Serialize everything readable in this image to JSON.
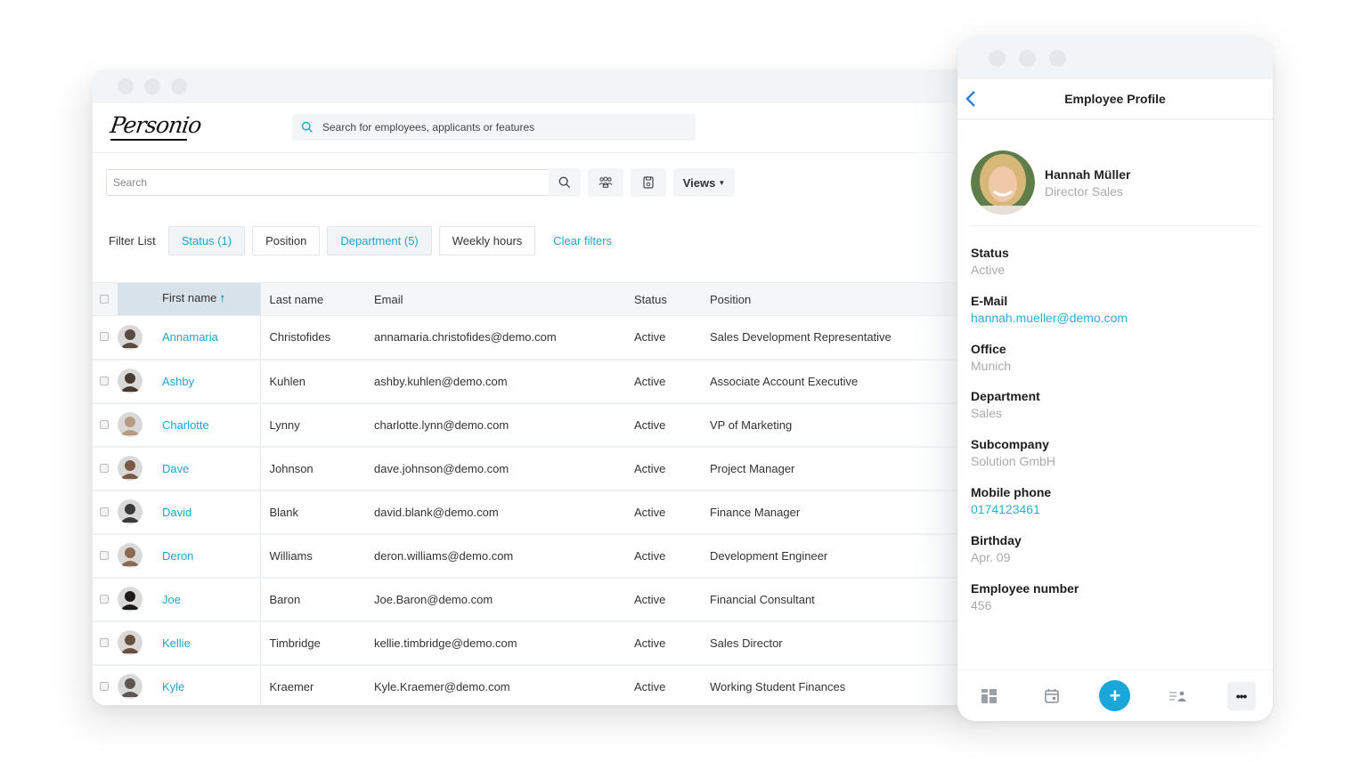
{
  "app": {
    "logo_text": "Personio",
    "global_search_placeholder": "Search for employees, applicants or features"
  },
  "toolbar": {
    "search_placeholder": "Search",
    "views_label": "Views",
    "icons": [
      "search-icon",
      "people-icon",
      "save-icon",
      "chevron-down-icon"
    ]
  },
  "filters": {
    "label": "Filter List",
    "chips": [
      {
        "label": "Status (1)",
        "active": true
      },
      {
        "label": "Position",
        "active": false
      },
      {
        "label": "Department (5)",
        "active": true
      },
      {
        "label": "Weekly hours",
        "active": false
      }
    ],
    "clear_label": "Clear filters"
  },
  "table": {
    "columns": [
      "First name",
      "Last name",
      "Email",
      "Status",
      "Position"
    ],
    "sorted_column": "First name",
    "sort_direction": "asc",
    "rows": [
      {
        "first": "Annamaria",
        "last": "Christofides",
        "email": "annamaria.christofides@demo.com",
        "status": "Active",
        "position": "Sales Development Representative",
        "avatar_color": "#5a4a42"
      },
      {
        "first": "Ashby",
        "last": "Kuhlen",
        "email": "ashby.kuhlen@demo.com",
        "status": "Active",
        "position": "Associate Account Executive",
        "avatar_color": "#4b3a30"
      },
      {
        "first": "Charlotte",
        "last": "Lynny",
        "email": "charlotte.lynn@demo.com",
        "status": "Active",
        "position": "VP of Marketing",
        "avatar_color": "#b89a7e"
      },
      {
        "first": "Dave",
        "last": "Johnson",
        "email": "dave.johnson@demo.com",
        "status": "Active",
        "position": "Project Manager",
        "avatar_color": "#7a5a44"
      },
      {
        "first": "David",
        "last": "Blank",
        "email": "david.blank@demo.com",
        "status": "Active",
        "position": "Finance Manager",
        "avatar_color": "#3a3a3a"
      },
      {
        "first": "Deron",
        "last": "Williams",
        "email": "deron.williams@demo.com",
        "status": "Active",
        "position": "Development Engineer",
        "avatar_color": "#8a6a50"
      },
      {
        "first": "Joe",
        "last": "Baron",
        "email": "Joe.Baron@demo.com",
        "status": "Active",
        "position": "Financial Consultant",
        "avatar_color": "#1e1a18"
      },
      {
        "first": "Kellie",
        "last": "Timbridge",
        "email": "kellie.timbridge@demo.com",
        "status": "Active",
        "position": "Sales Director",
        "avatar_color": "#6a4e3e"
      },
      {
        "first": "Kyle",
        "last": "Kraemer",
        "email": "Kyle.Kraemer@demo.com",
        "status": "Active",
        "position": "Working Student Finances",
        "avatar_color": "#5e554f"
      }
    ]
  },
  "mobile": {
    "title": "Employee Profile",
    "profile": {
      "name": "Hannah Müller",
      "role": "Director Sales"
    },
    "fields": [
      {
        "label": "Status",
        "value": "Active",
        "link": false
      },
      {
        "label": "E-Mail",
        "value": "hannah.mueller@demo.com",
        "link": true
      },
      {
        "label": "Office",
        "value": "Munich",
        "link": false
      },
      {
        "label": "Department",
        "value": "Sales",
        "link": false
      },
      {
        "label": "Subcompany",
        "value": "Solution GmbH",
        "link": false
      },
      {
        "label": "Mobile phone",
        "value": "0174123461",
        "link": true
      },
      {
        "label": "Birthday",
        "value": "Apr. 09",
        "link": false
      },
      {
        "label": "Employee number",
        "value": "456",
        "link": false
      }
    ],
    "tabbar": {
      "icons": [
        "dashboard-icon",
        "calendar-icon",
        "add-icon",
        "people-list-icon",
        "more-icon"
      ],
      "fab_label": "+",
      "more_label": "•••"
    }
  },
  "colors": {
    "accent": "#1fa5cc",
    "fab": "#1aa6d9",
    "header_bg": "#f2f5f8",
    "sorted_header_bg": "#d7e2ea"
  }
}
